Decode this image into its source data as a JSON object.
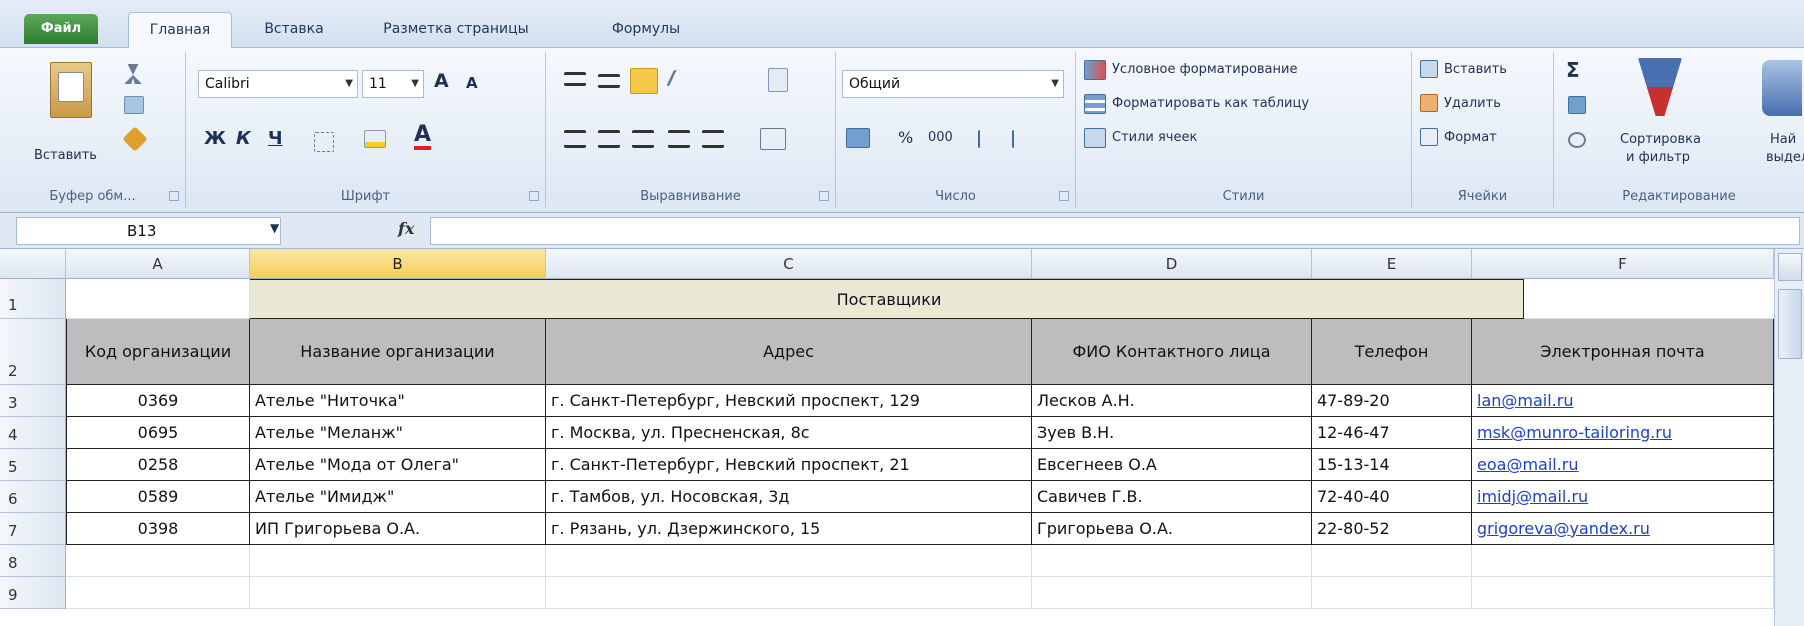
{
  "tabs": [
    "Файл",
    "Главная",
    "Вставка",
    "Разметка страницы",
    "Формулы"
  ],
  "ribbon": {
    "clipboard": {
      "paste": "Вставить",
      "label": "Буфер обм..."
    },
    "font": {
      "name": "Calibri",
      "size": "11",
      "bold": "Ж",
      "italic": "К",
      "underline": "Ч",
      "grow": "A",
      "shrink": "A",
      "label": "Шрифт"
    },
    "alignment": {
      "label": "Выравнивание"
    },
    "number": {
      "format": "Общий",
      "percent": "%",
      "thousands": "000",
      "label": "Число"
    },
    "styles": {
      "conditional": "Условное форматирование",
      "as_table": "Форматировать как таблицу",
      "cell_styles": "Стили ячеек",
      "label": "Стили"
    },
    "cells": {
      "insert": "Вставить",
      "delete": "Удалить",
      "format": "Формат",
      "label": "Ячейки"
    },
    "editing": {
      "sigma": "Σ",
      "sort": "Сортировка",
      "sort2": "и фильтр",
      "find": "Най",
      "find2": "выдел",
      "label": "Редактирование"
    }
  },
  "formula_bar": {
    "name_box": "B13",
    "fx": "fx",
    "value": ""
  },
  "columns": [
    "A",
    "B",
    "C",
    "D",
    "E",
    "F"
  ],
  "rows": [
    "1",
    "2",
    "3",
    "4",
    "5",
    "6",
    "7",
    "8",
    "9"
  ],
  "table": {
    "title": "Поставщики",
    "headers": [
      "Код организации",
      "Название организации",
      "Адрес",
      "ФИО Контактного лица",
      "Телефон",
      "Электронная почта"
    ],
    "records": [
      [
        "0369",
        "Ателье \"Ниточка\"",
        "г. Санкт-Петербург, Невский проспект, 129",
        "Лесков А.Н.",
        "47-89-20",
        "lan@mail.ru"
      ],
      [
        "0695",
        "Ателье \"Меланж\"",
        "г. Москва, ул. Пресненская, 8с",
        "Зуев В.Н.",
        "12-46-47",
        "msk@munro-tailoring.ru"
      ],
      [
        "0258",
        "Ателье \"Мода от Олега\"",
        "г. Санкт-Петербург, Невский проспект, 21",
        "Евсегнеев О.А",
        "15-13-14",
        "eoa@mail.ru"
      ],
      [
        "0589",
        "Ателье \"Имидж\"",
        "г. Тамбов, ул. Носовская,  3д",
        "Савичев Г.В.",
        "72-40-40",
        "imidj@mail.ru"
      ],
      [
        "0398",
        "ИП Григорьева О.А.",
        "г. Рязань, ул. Дзержинского, 15",
        "Григорьева О.А.",
        "22-80-52",
        "grigoreva@yandex.ru"
      ]
    ]
  },
  "colors": {
    "header_fill": "#bdbdbd",
    "title_fill": "#ece8d6",
    "link": "#1e3fc8",
    "selected_col": "#f4cf5a",
    "file_tab": "#2f7d2f"
  }
}
